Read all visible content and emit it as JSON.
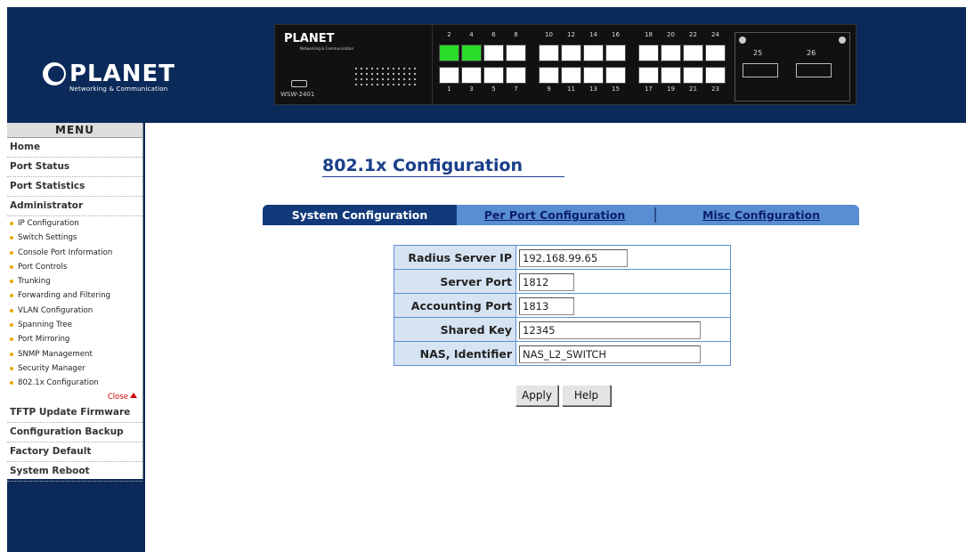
{
  "branding": {
    "logo_name": "PLANET",
    "logo_tagline": "Networking & Communication"
  },
  "device_panel": {
    "brand": "PLANET",
    "brand_sub": "Networking & Communication",
    "model": "WSW-2401",
    "top_port_numbers": [
      "2",
      "4",
      "6",
      "8",
      "10",
      "12",
      "14",
      "16",
      "18",
      "20",
      "22",
      "24"
    ],
    "bottom_port_numbers": [
      "1",
      "3",
      "5",
      "7",
      "9",
      "11",
      "13",
      "15",
      "17",
      "19",
      "21",
      "23"
    ],
    "active_ports": [
      "2",
      "4"
    ],
    "sfp_port_numbers": [
      "25",
      "26"
    ],
    "colors": {
      "active_port": "#2bdc2b",
      "idle_port": "#ffffff"
    }
  },
  "menu": {
    "title": "MENU",
    "items_top": [
      "Home",
      "Port Status",
      "Port Statistics",
      "Administrator"
    ],
    "admin_subitems": [
      "IP Configuration",
      "Switch Settings",
      "Console Port Information",
      "Port Controls",
      "Trunking",
      "Forwarding and Filtering",
      "VLAN Configuration",
      "Spanning Tree",
      "Port Mirroring",
      "SNMP Management",
      "Security Manager",
      "802.1x Configuration"
    ],
    "close_label": "Close",
    "items_bottom": [
      "TFTP Update Firmware",
      "Configuration Backup",
      "Factory Default",
      "System Reboot"
    ]
  },
  "page": {
    "title": "802.1x Configuration"
  },
  "tabs": {
    "system": "System Configuration",
    "per_port": "Per Port Configuration",
    "misc": "Misc Configuration",
    "selected": "System Configuration"
  },
  "form": {
    "radius_server_ip": {
      "label": "Radius Server IP",
      "value": "192.168.99.65"
    },
    "server_port": {
      "label": "Server Port",
      "value": "1812"
    },
    "accounting_port": {
      "label": "Accounting Port",
      "value": "1813"
    },
    "shared_key": {
      "label": "Shared Key",
      "value": "12345"
    },
    "nas_identifier": {
      "label": "NAS, Identifier",
      "value": "NAS_L2_SWITCH"
    }
  },
  "buttons": {
    "apply": "Apply",
    "help": "Help"
  },
  "theme": {
    "banner_bg": "#0b2a5a",
    "title_color": "#1a3e8a",
    "tab_bar": "#5a8ed2",
    "tab_selected": "#123a7a",
    "menu_bullet": "#e8a900"
  }
}
